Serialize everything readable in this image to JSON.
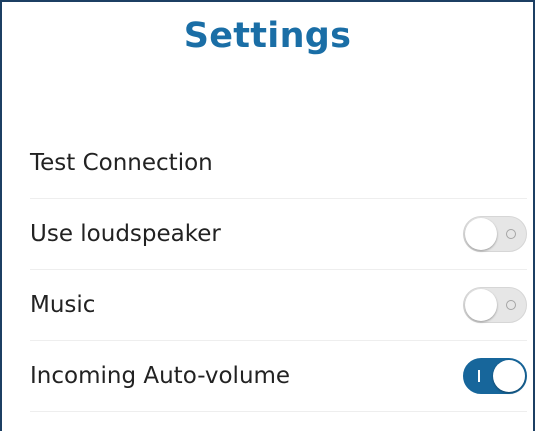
{
  "header": {
    "title": "Settings"
  },
  "settings": {
    "items": [
      {
        "label": "Test Connection",
        "type": "action"
      },
      {
        "label": "Use loudspeaker",
        "type": "toggle",
        "enabled": false
      },
      {
        "label": "Music",
        "type": "toggle",
        "enabled": false
      },
      {
        "label": "Incoming Auto-volume",
        "type": "toggle",
        "enabled": true
      }
    ]
  },
  "colors": {
    "title": "#1a6ea6",
    "toggle_on": "#17669b",
    "toggle_off": "#e6e6e6",
    "frame": "#1c3f63"
  },
  "icons": {
    "toggle_off_indicator": "circle-off-icon",
    "toggle_on_indicator": "bar-on-icon"
  }
}
